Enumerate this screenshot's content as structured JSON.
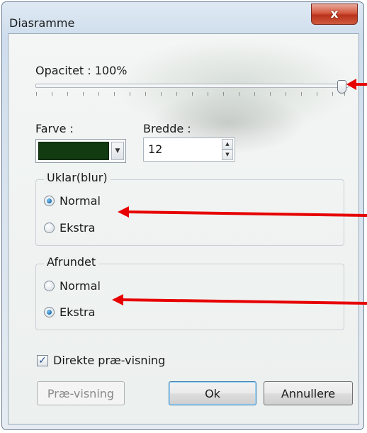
{
  "window": {
    "title": "Diasramme",
    "close_glyph": "x"
  },
  "opacity": {
    "label": "Opacitet : 100%",
    "value": 1.0
  },
  "color": {
    "label": "Farve :",
    "swatch": "#123b12"
  },
  "width": {
    "label": "Bredde :",
    "value": "12"
  },
  "blur_group": {
    "title": "Uklar(blur)",
    "options": [
      {
        "label": "Normal",
        "selected": true
      },
      {
        "label": "Ekstra",
        "selected": false
      }
    ]
  },
  "rounded_group": {
    "title": "Afrundet",
    "options": [
      {
        "label": "Normal",
        "selected": false
      },
      {
        "label": "Ekstra",
        "selected": true
      }
    ]
  },
  "preview_checkbox": {
    "label": "Direkte præ-visning",
    "checked": true
  },
  "buttons": {
    "preview": "Præ-visning",
    "ok": "Ok",
    "cancel": "Annullere"
  },
  "annotation_color": "#e60000"
}
